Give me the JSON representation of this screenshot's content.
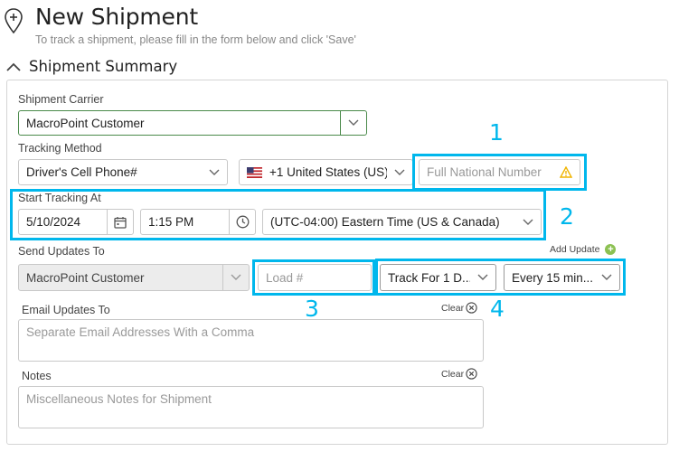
{
  "header": {
    "title": "New Shipment",
    "subtitle": "To track a shipment, please fill in the form below and click 'Save'"
  },
  "section": {
    "title": "Shipment Summary"
  },
  "carrier": {
    "label": "Shipment Carrier",
    "value": "MacroPoint Customer"
  },
  "tracking": {
    "label": "Tracking Method",
    "method": "Driver's Cell Phone#",
    "country": "+1 United States (US)",
    "phone_placeholder": "Full National Number"
  },
  "start": {
    "label": "Start Tracking At",
    "date": "5/10/2024",
    "time": "1:15 PM",
    "timezone": "(UTC-04:00) Eastern Time (US & Canada)"
  },
  "updates": {
    "label": "Send Updates To",
    "add_label": "Add Update",
    "recipient": "MacroPoint Customer",
    "load_placeholder": "Load #",
    "duration": "Track For 1 D...",
    "interval": "Every 15 min..."
  },
  "email": {
    "label": "Email Updates To",
    "clear": "Clear",
    "placeholder": "Separate Email Addresses With a Comma"
  },
  "notes": {
    "label": "Notes",
    "clear": "Clear",
    "placeholder": "Miscellaneous Notes for Shipment"
  },
  "callouts": {
    "n1": "1",
    "n2": "2",
    "n3": "3",
    "n4": "4"
  },
  "colors": {
    "highlight": "#00b7ec",
    "carrier_border": "#4a8a4a",
    "add_icon": "#8cc152",
    "warning": "#f0b400"
  }
}
